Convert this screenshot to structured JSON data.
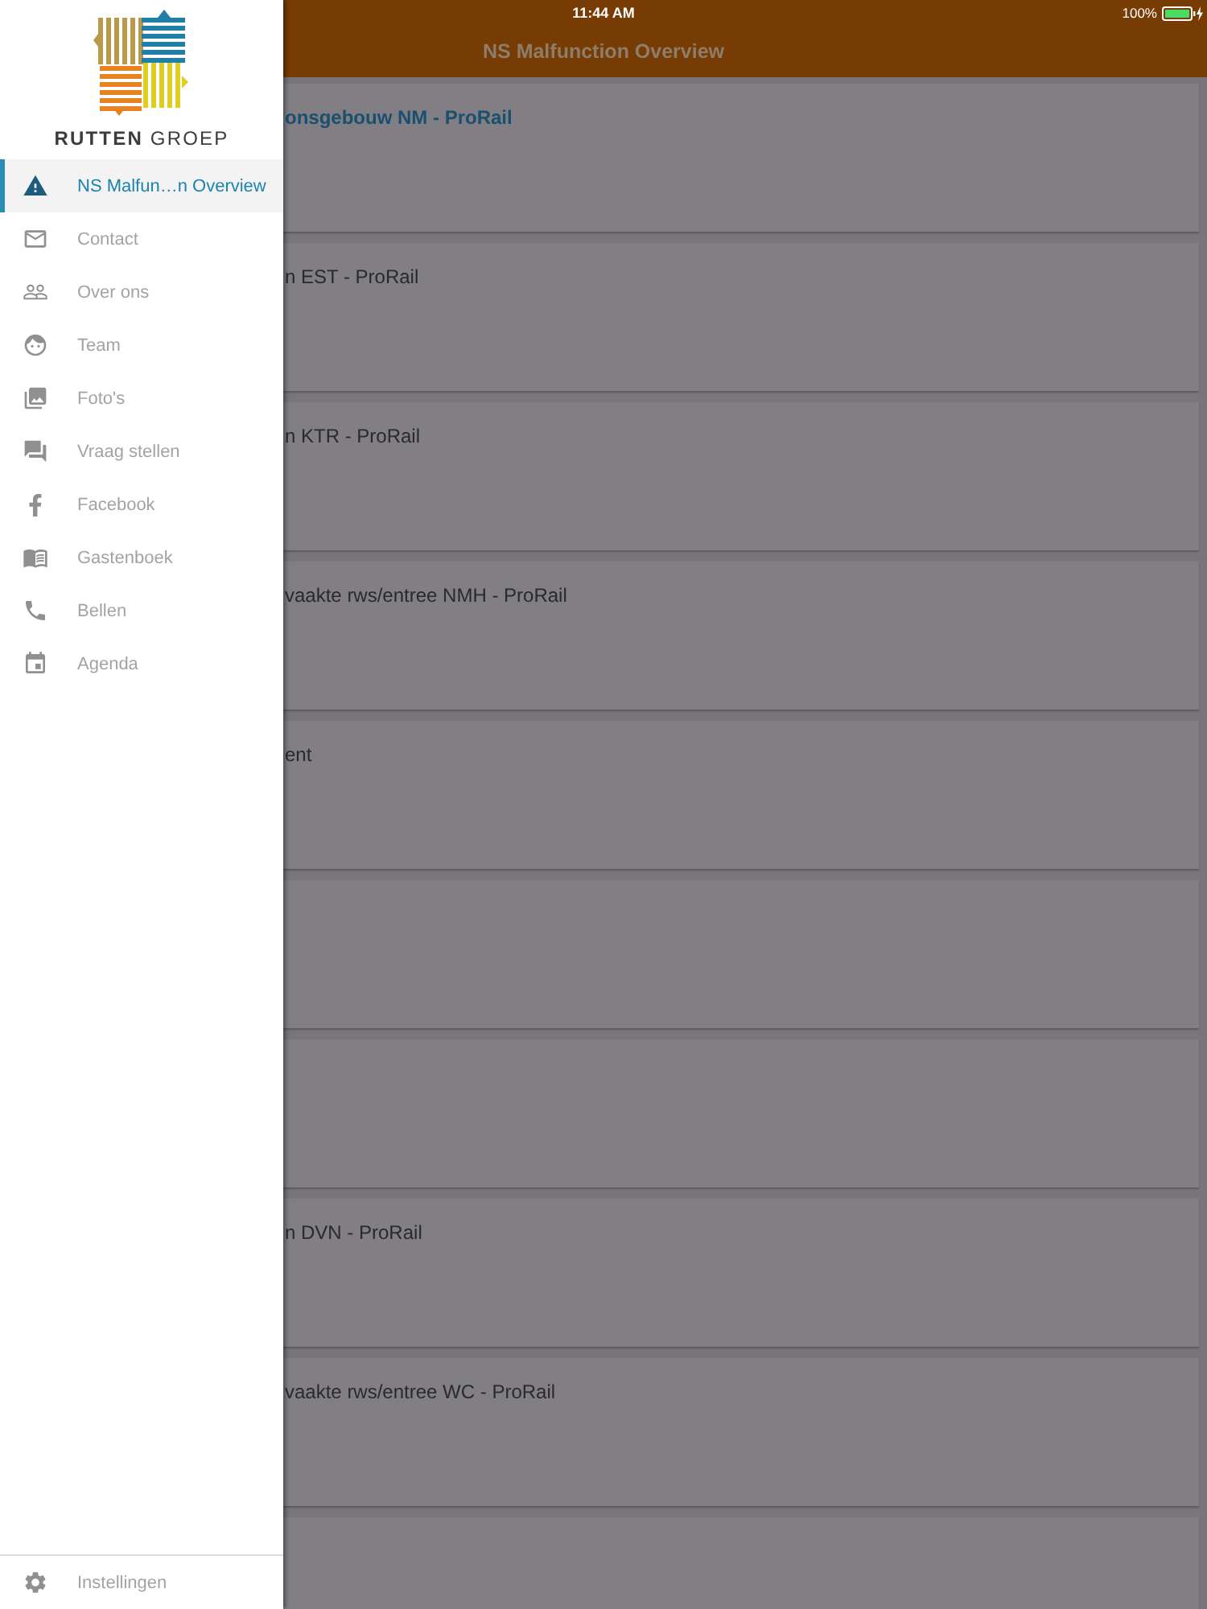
{
  "status_bar": {
    "time": "11:44 AM",
    "battery": "100%"
  },
  "drawer": {
    "logo_text": "**RUTTEN** GROEP",
    "items": [
      {
        "label": "NS Malfun…n Overview",
        "selected": true
      },
      {
        "label": "Contact",
        "selected": false
      },
      {
        "label": "Over ons",
        "selected": false
      },
      {
        "label": "Team",
        "selected": false
      },
      {
        "label": "Foto's",
        "selected": false
      },
      {
        "label": "Vraag stellen",
        "selected": false
      },
      {
        "label": "Facebook",
        "selected": false
      },
      {
        "label": "Gastenboek",
        "selected": false
      },
      {
        "label": "Bellen",
        "selected": false
      },
      {
        "label": "Agenda",
        "selected": false
      }
    ],
    "footer_item": {
      "label": "Instellingen"
    }
  },
  "nav_bar": {
    "title": "NS Malfunction Overview"
  },
  "cards": [
    {
      "kind": "titled",
      "title": "onsgebouw NM - ProRail",
      "highlighted": true
    },
    {
      "kind": "titled",
      "title": "n EST - ProRail",
      "highlighted": false
    },
    {
      "kind": "titled",
      "title": "n KTR - ProRail",
      "highlighted": false
    },
    {
      "kind": "titled",
      "title": "vaakte rws/entree NMH - ProRail",
      "highlighted": false
    },
    {
      "kind": "titled",
      "title": "ent",
      "highlighted": false
    },
    {
      "kind": "blank"
    },
    {
      "kind": "blank"
    },
    {
      "kind": "titled",
      "title": "n DVN - ProRail",
      "highlighted": false
    },
    {
      "kind": "titled",
      "title": "vaakte rws/entree WC - ProRail",
      "highlighted": false
    },
    {
      "kind": "blank"
    }
  ]
}
